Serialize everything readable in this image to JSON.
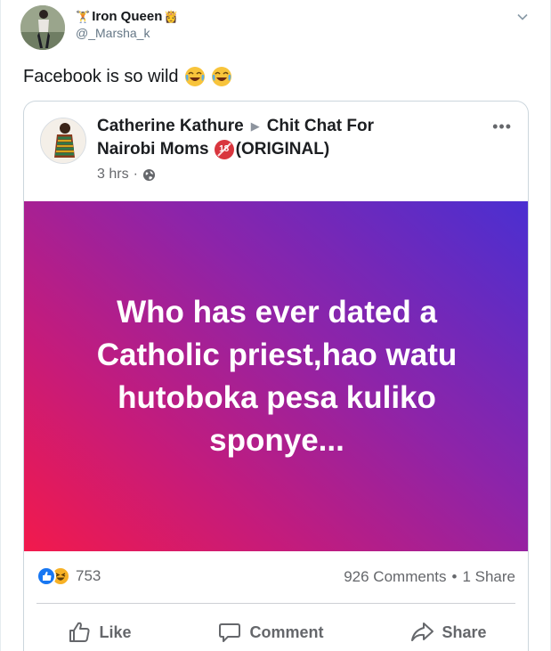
{
  "tweet": {
    "display_name": "Iron Queen",
    "handle": "@_Marsha_k",
    "text": "Facebook is so wild",
    "name_emoji_left": "🏋",
    "name_emoji_right": "👸"
  },
  "fb_post": {
    "author": "Catherine Kathure",
    "group": "Chit Chat For Nairobi Moms",
    "group_line1": "Chit Chat For",
    "group_line2": "Nairobi Moms",
    "group_suffix": "(ORIGINAL)",
    "badge": "18",
    "time": "3 hrs",
    "time_sep": "·",
    "body": "Who has ever dated a Catholic priest,hao watu hutoboka pesa kuliko sponye...",
    "reactions_count": "753",
    "comments": "926 Comments",
    "stat_sep": "•",
    "shares": "1 Share",
    "actions": {
      "like": "Like",
      "comment": "Comment",
      "share": "Share"
    },
    "more": "•••"
  },
  "colors": {
    "fb_blue": "#1877f2",
    "gradient_start": "#f21a4c",
    "gradient_end": "#4a2fd1",
    "muted": "#65676b"
  },
  "icons": [
    "chevron-down-icon",
    "laughing-emoji-icon",
    "globe-icon",
    "like-reaction-icon",
    "haha-reaction-icon",
    "thumbs-up-icon",
    "comment-icon",
    "share-icon",
    "more-icon"
  ]
}
